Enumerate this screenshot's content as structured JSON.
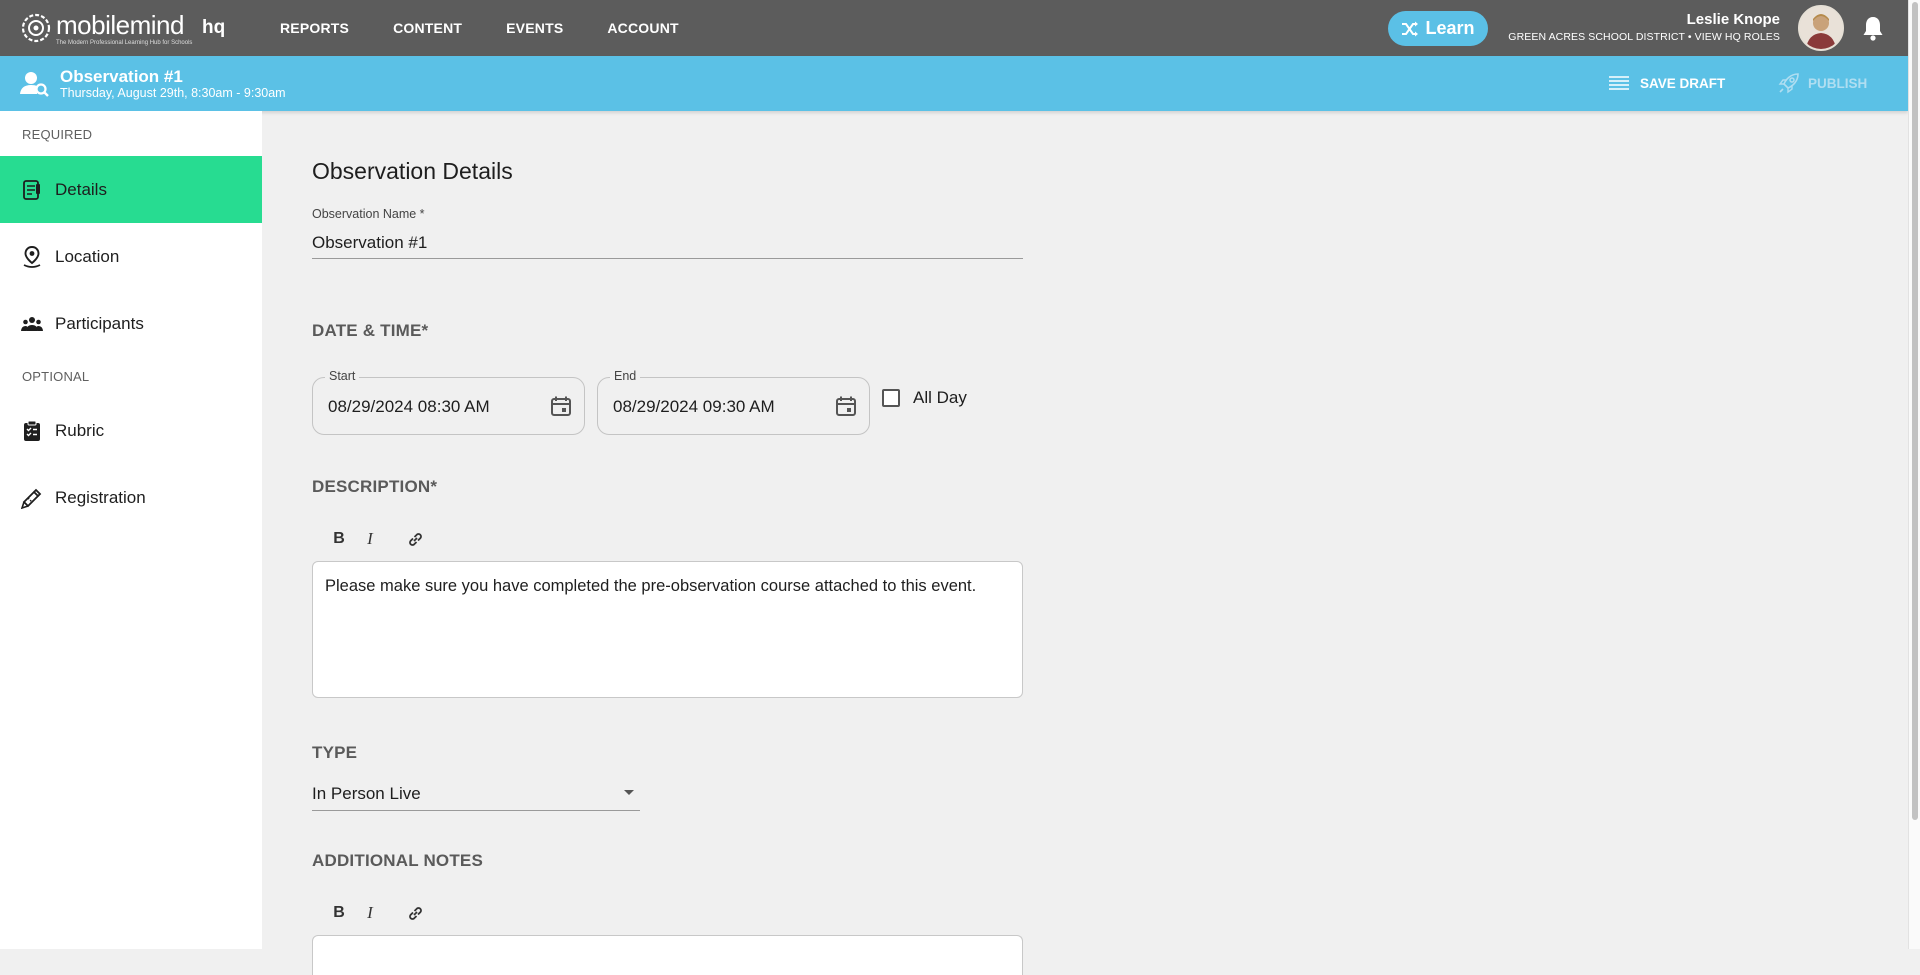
{
  "app": {
    "logo_word": "mobilemind",
    "logo_tagline": "The Modern Professional Learning Hub for Schools",
    "logo_hq": "hq"
  },
  "nav": {
    "items": [
      {
        "label": "REPORTS"
      },
      {
        "label": "CONTENT"
      },
      {
        "label": "EVENTS"
      },
      {
        "label": "ACCOUNT"
      }
    ],
    "learn_label": "Learn"
  },
  "user": {
    "name": "Leslie Knope",
    "subtitle": "GREEN ACRES SCHOOL DISTRICT • VIEW HQ ROLES",
    "avatar_icon": "user-avatar",
    "bell_icon": "bell-icon"
  },
  "header": {
    "title": "Observation #1",
    "date": "Thursday, August 29th, 8:30am - 9:30am",
    "save_draft_label": "SAVE DRAFT",
    "publish_label": "PUBLISH"
  },
  "sidebar": {
    "required_label": "REQUIRED",
    "optional_label": "OPTIONAL",
    "items": [
      {
        "label": "Details",
        "icon": "clipboard-icon",
        "active": true
      },
      {
        "label": "Location",
        "icon": "location-pin-icon",
        "active": false
      },
      {
        "label": "Participants",
        "icon": "people-icon",
        "active": false
      },
      {
        "label": "Rubric",
        "icon": "checklist-icon",
        "active": false
      },
      {
        "label": "Registration",
        "icon": "ticket-icon",
        "active": false
      }
    ]
  },
  "form": {
    "heading": "Observation Details",
    "name_label": "Observation Name *",
    "name_value": "Observation #1",
    "datetime_title": "DATE & TIME*",
    "start_label": "Start",
    "start_value": "08/29/2024 08:30 AM",
    "end_label": "End",
    "end_value": "08/29/2024 09:30 AM",
    "all_day_label": "All Day",
    "all_day_checked": false,
    "description_title": "DESCRIPTION*",
    "description_text": "Please make sure you have completed the pre-observation course attached to this event.",
    "toolbar": {
      "bold": "B",
      "italic": "I"
    },
    "type_title": "TYPE",
    "type_value": "In Person Live",
    "notes_title": "ADDITIONAL NOTES"
  },
  "colors": {
    "topbar": "#5c5c5c",
    "subbar": "#5bc1e6",
    "active_item": "#27dc91",
    "learn_button": "#5bc0e6"
  }
}
